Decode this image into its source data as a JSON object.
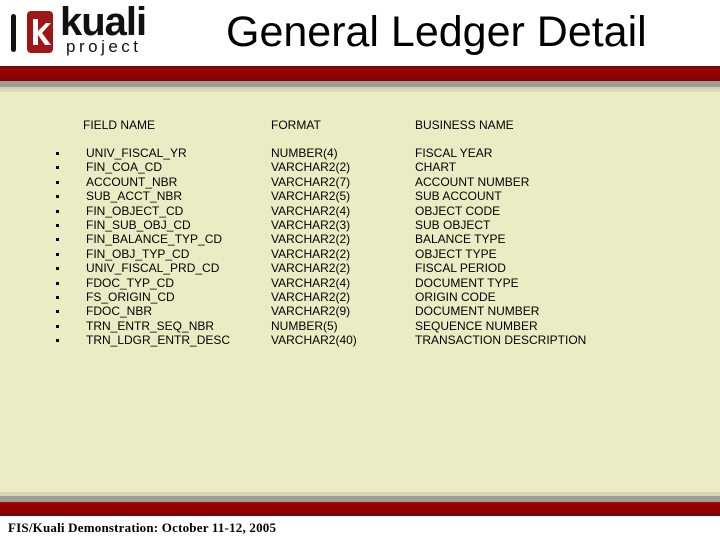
{
  "header": {
    "logo": {
      "word": "kuali",
      "sub": "project",
      "icon": "kuali-k-logo-icon"
    },
    "title": "General Ledger Detail"
  },
  "colors": {
    "brand_red": "#930000",
    "band_gray": "#a09d94",
    "content_bg": "#ebebc4"
  },
  "table": {
    "headers": {
      "field": "FIELD NAME",
      "format": "FORMAT",
      "business": "BUSINESS NAME"
    },
    "rows": [
      {
        "field": "UNIV_FISCAL_YR",
        "format": "NUMBER(4)",
        "business": "FISCAL YEAR"
      },
      {
        "field": "FIN_COA_CD",
        "format": "VARCHAR2(2)",
        "business": "CHART"
      },
      {
        "field": "ACCOUNT_NBR",
        "format": "VARCHAR2(7)",
        "business": "ACCOUNT NUMBER"
      },
      {
        "field": "SUB_ACCT_NBR",
        "format": "VARCHAR2(5)",
        "business": "SUB ACCOUNT"
      },
      {
        "field": "FIN_OBJECT_CD",
        "format": "VARCHAR2(4)",
        "business": "OBJECT CODE"
      },
      {
        "field": "FIN_SUB_OBJ_CD",
        "format": "VARCHAR2(3)",
        "business": "SUB OBJECT"
      },
      {
        "field": "FIN_BALANCE_TYP_CD",
        "format": "VARCHAR2(2)",
        "business": "BALANCE TYPE"
      },
      {
        "field": "FIN_OBJ_TYP_CD",
        "format": "VARCHAR2(2)",
        "business": "OBJECT TYPE"
      },
      {
        "field": "UNIV_FISCAL_PRD_CD",
        "format": "VARCHAR2(2)",
        "business": "FISCAL PERIOD"
      },
      {
        "field": "FDOC_TYP_CD",
        "format": "VARCHAR2(4)",
        "business": "DOCUMENT TYPE"
      },
      {
        "field": "FS_ORIGIN_CD",
        "format": "VARCHAR2(2)",
        "business": "ORIGIN CODE"
      },
      {
        "field": "FDOC_NBR",
        "format": "VARCHAR2(9)",
        "business": "DOCUMENT NUMBER"
      },
      {
        "field": "TRN_ENTR_SEQ_NBR",
        "format": "NUMBER(5)",
        "business": "SEQUENCE NUMBER"
      },
      {
        "field": "TRN_LDGR_ENTR_DESC",
        "format": "VARCHAR2(40)",
        "business": "TRANSACTION DESCRIPTION"
      }
    ]
  },
  "footer": {
    "text": "FIS/Kuali Demonstration:  October 11-12, 2005"
  }
}
